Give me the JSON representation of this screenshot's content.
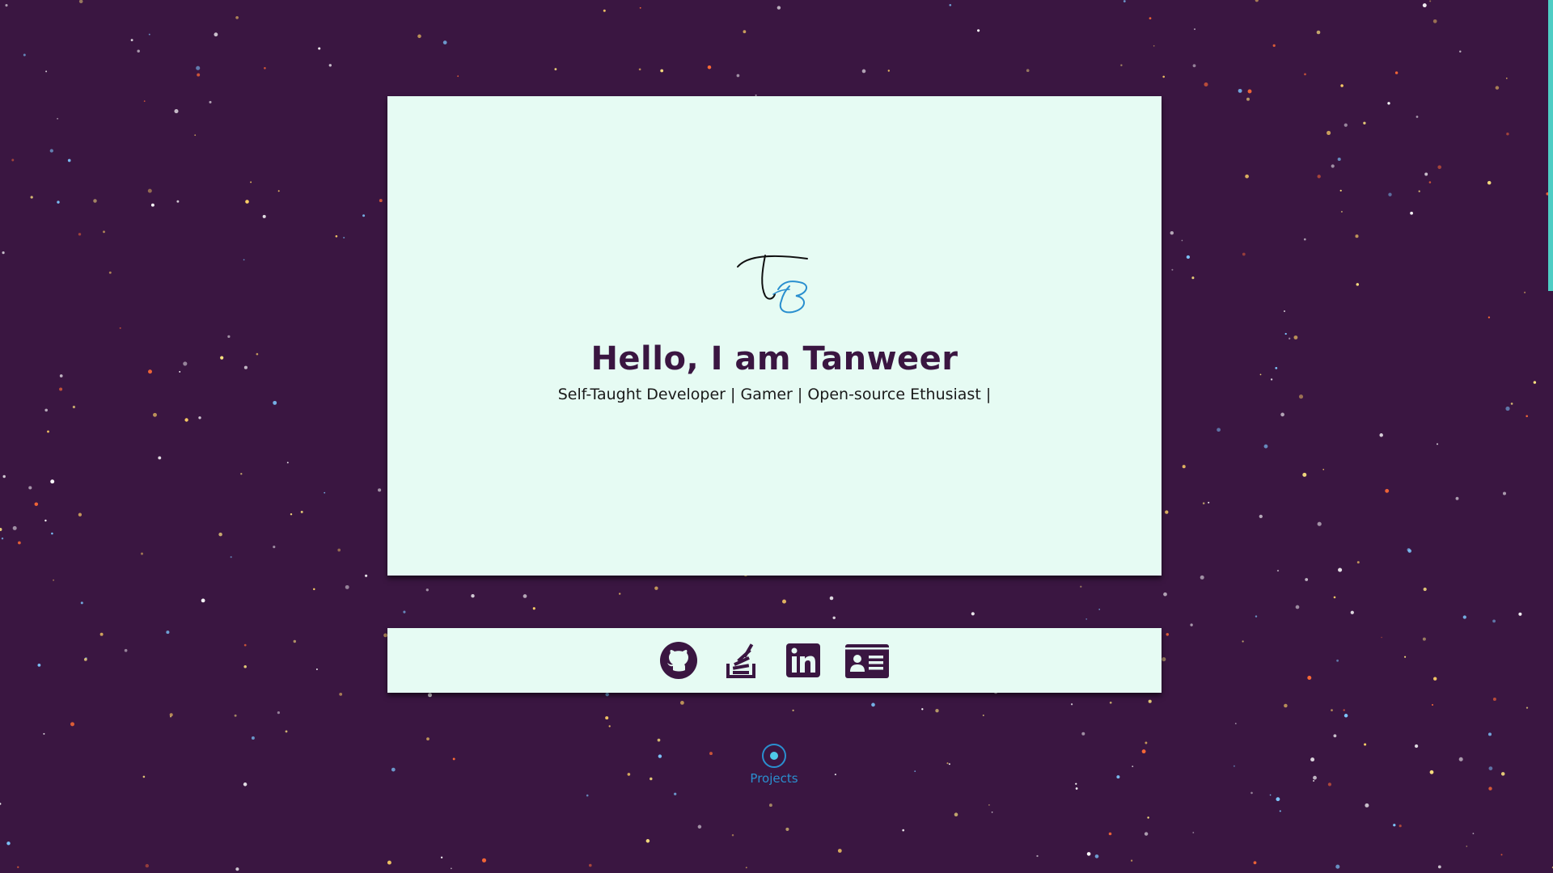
{
  "hero": {
    "title": "Hello, I am Tanweer",
    "subtitle": "Self-Taught Developer | Gamer | Open-source Ethusiast |",
    "logo_icon": "tb-signature-logo"
  },
  "social": {
    "items": [
      {
        "icon": "github-icon"
      },
      {
        "icon": "stackoverflow-icon"
      },
      {
        "icon": "linkedin-icon"
      },
      {
        "icon": "contact-card-icon"
      }
    ]
  },
  "nav": {
    "projects_label": "Projects"
  },
  "colors": {
    "background": "#3a1641",
    "card": "#e6fbf3",
    "accent": "#2a8fcf",
    "icon": "#3a1641"
  }
}
